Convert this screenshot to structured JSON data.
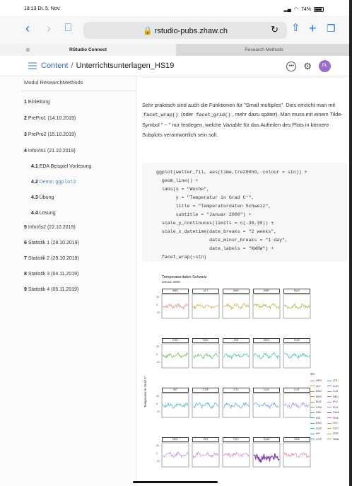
{
  "status": {
    "time": "18:13  Di. 5. Nov.",
    "battery": "74%"
  },
  "browser": {
    "url": "rstudio-pubs.zhaw.ch"
  },
  "tabs": [
    {
      "label": "RStudio Connect"
    },
    {
      "label": "Research Methods"
    }
  ],
  "header": {
    "crumb_root": "Content",
    "crumb_sep": "/",
    "crumb_current": "Unterrichtsunterlagen_HS19",
    "avatar_initials": "PL"
  },
  "sidebar": {
    "title": "Modul ResearchMethods",
    "items": [
      {
        "num": "1",
        "label": "Einleitung"
      },
      {
        "num": "2",
        "label": "PrePro1 (14.10.2019)"
      },
      {
        "num": "3",
        "label": "PrePro2 (15.10.2019)"
      },
      {
        "num": "4",
        "label": "InfoVis1 (21.10.2019)"
      },
      {
        "num": "4.1",
        "label": "EDA Beispiel Vorlesung"
      },
      {
        "num": "4.2",
        "label": "Demo: ",
        "code": "ggplot2"
      },
      {
        "num": "4.3",
        "label": "Übung"
      },
      {
        "num": "4.4",
        "label": "Lösung"
      },
      {
        "num": "5",
        "label": "InfoVis2 (22.10.2019)"
      },
      {
        "num": "6",
        "label": "Statistik 1 (28.10.2019)"
      },
      {
        "num": "7",
        "label": "Statistik 2 (29.10.2019)"
      },
      {
        "num": "8",
        "label": "Statistik 3 (04.11.2019)"
      },
      {
        "num": "9",
        "label": "Statistik 4 (05.11.2019)"
      }
    ]
  },
  "content": {
    "p1a": "Sehr praktisch sind auch die Funktionen für \"Small multiples\". Dies erreicht man mit ",
    "p1_code1": "facet_wrap()",
    "p1b": " (oder ",
    "p1_code2": "facet_grid()",
    "p1c": ", mehr dazu später). Man muss mit einem Tilde-Symbol \" ~ \" nur festlegen, welche ",
    "p1_em": "Variable",
    "p1d": " für das Aufteilen des Plots in kleinere Subplots verantwortlich sein soll.",
    "code": [
      "ggplot(wetter_fil, aes(time,tre200h0, colour = stn)) +",
      "  geom_line() +",
      "  labs(x = \"Woche\",",
      "       y = \"Temperatur in Grad C°\",",
      "       title = \"Temperaturdaten Schweiz\",",
      "       subtitle = \"Januar 2000\") +",
      "  scale_y_continuous(limits = c(-30,30)) +",
      "  scale_x_datetime(date_breaks = \"2 weeks\",",
      "                   date_minor_breaks = \"1 day\",",
      "                   date_labels = \"KW%W\") +",
      "  facet_wrap(~stn)"
    ]
  },
  "figure": {
    "title": "Temperaturdaten Schweiz",
    "subtitle": "Januar 2000",
    "ylabel": "Temperatur in Grad C°",
    "legend_title": "stn",
    "yticks": [
      "20",
      "0",
      "-20"
    ],
    "rows": [
      [
        "ABO",
        "ALT",
        "BAS",
        "BER",
        "BUS"
      ],
      [
        "CHU",
        "DAV",
        "DIS",
        "ENG",
        "GVE"
      ],
      [
        "INT",
        "COF",
        "OTL",
        "LUG",
        "LUZ"
      ],
      [
        "NEU",
        "PIO",
        "PUY",
        "SAM",
        "SHA"
      ]
    ],
    "legend_left": [
      "ABO",
      "ALT",
      "BAS",
      "BER",
      "BUS",
      "CHU",
      "DAV",
      "DIS",
      "ENG",
      "GVE",
      "INT",
      "COF"
    ],
    "legend_right": [
      "OTL",
      "LUG",
      "LUZ",
      "NEU",
      "PIO",
      "PUY",
      "SAM",
      "SHA",
      "SIO",
      "STG",
      "ZER",
      "SMA"
    ],
    "colors": {
      "row1": [
        "#e8766e",
        "#d89a3a",
        "#c4a020",
        "#a8aa20",
        "#8aae20"
      ],
      "row2": [
        "#62b22e",
        "#3cb44c",
        "#20b46c",
        "#20b48c",
        "#20b4a8"
      ],
      "row3": [
        "#20b0c0",
        "#20a8d4",
        "#30a0e0",
        "#5a94ec",
        "#8a88ee"
      ],
      "row4": [
        "#a87ee8",
        "#c474dc",
        "#d86ec8",
        "#7a3aa8",
        "#f06eb0"
      ]
    }
  }
}
